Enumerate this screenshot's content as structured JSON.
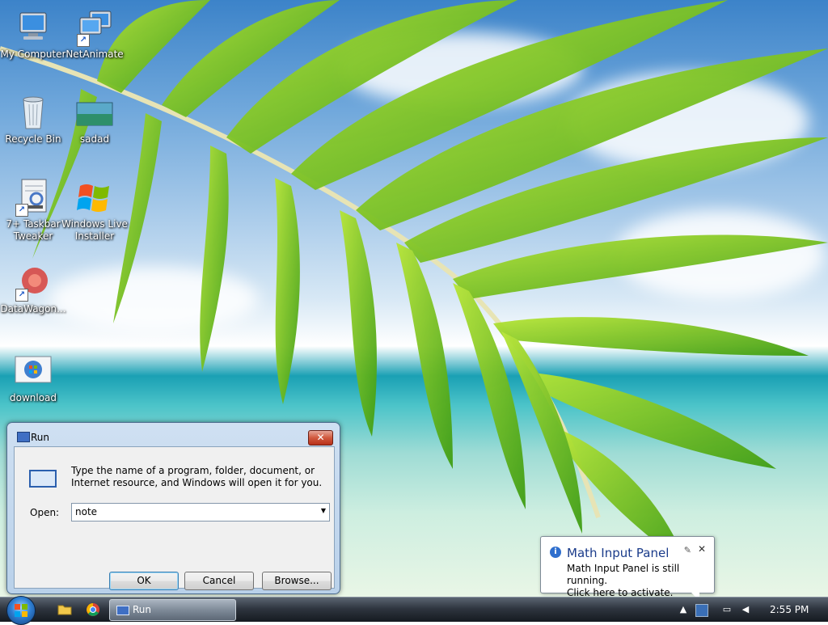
{
  "desktop": {
    "icons": [
      {
        "label_lines": [
          "My Computer"
        ],
        "icon": "computer-icon"
      },
      {
        "label_lines": [
          "NetAnimate"
        ],
        "icon": "network-computer-icon",
        "shortcut": true
      },
      {
        "label_lines": [
          "Recycle Bin"
        ],
        "icon": "recycle-bin-icon"
      },
      {
        "label_lines": [
          "sadad"
        ],
        "icon": "image-file-icon"
      },
      {
        "label_lines": [
          "7+ Taskbar",
          "Tweaker"
        ],
        "icon": "tweaker-app-icon",
        "shortcut": true
      },
      {
        "label_lines": [
          "Windows Live",
          "Installer"
        ],
        "icon": "windows-logo-icon"
      },
      {
        "label_lines": [
          "DataWagon..."
        ],
        "icon": "datawagon-app-icon",
        "shortcut": true
      },
      {
        "label_lines": [
          "download"
        ],
        "icon": "windows-orb-file-icon"
      }
    ]
  },
  "run_dialog": {
    "title": "Run",
    "close_glyph": "✕",
    "description": "Type the name of a program, folder, document, or Internet resource, and Windows will open it for you.",
    "open_label": "Open:",
    "open_value": "note",
    "dropdown_glyph": "▼",
    "ok_label": "OK",
    "cancel_label": "Cancel",
    "browse_label": "Browse..."
  },
  "notification": {
    "title": "Math Input Panel",
    "text_line1": "Math Input Panel is still running.",
    "text_line2": "Click here to activate.",
    "info_glyph": "i",
    "close_glyph": "✕",
    "pin_glyph": "✎"
  },
  "taskbar": {
    "active_task_label": "Run",
    "clock": "2:55 PM",
    "tray_up_glyph": "▲",
    "quick_launch": [
      "folder-icon",
      "chrome-icon"
    ]
  },
  "colors": {
    "taskbar_dark": "#151a20",
    "dialog_frame": "#b9d1ea",
    "close_red": "#d1593e",
    "accent_blue": "#2f6fce"
  }
}
